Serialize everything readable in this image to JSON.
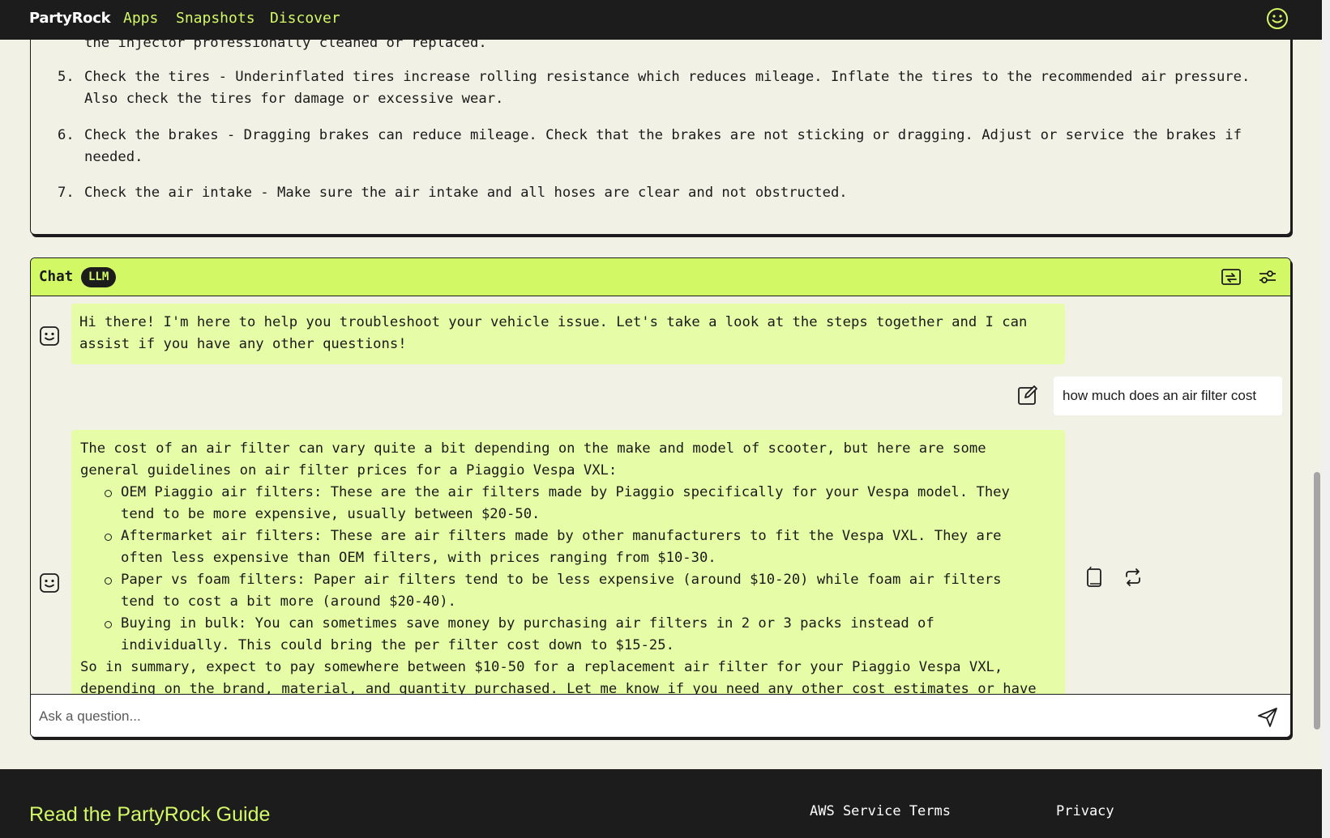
{
  "nav": {
    "brand": "PartyRock",
    "links": [
      "Apps",
      "Snapshots",
      "Discover"
    ],
    "avatar_icon": "smiley-icon"
  },
  "output": {
    "clipped_text": "the injector professionally cleaned or replaced.",
    "items": [
      {
        "num": "5.",
        "text": "Check the tires - Underinflated tires increase rolling resistance which reduces mileage. Inflate the tires to the recommended air pressure. Also check the tires for damage or excessive wear."
      },
      {
        "num": "6.",
        "text": "Check the brakes - Dragging brakes can reduce mileage. Check that the brakes are not sticking or dragging. Adjust or service the brakes if needed."
      },
      {
        "num": "7.",
        "text": "Check the air intake - Make sure the air intake and all hoses are clear and not obstructed."
      }
    ]
  },
  "chat": {
    "title": "Chat",
    "badge": "LLM",
    "header_icons": [
      "snapshot-icon",
      "settings-sliders-icon"
    ],
    "messages": {
      "bot1": "Hi there! I'm here to help you troubleshoot your vehicle issue. Let's take a look at the steps together and I can assist if you have any other questions!",
      "user1": "how much does an air filter cost",
      "bot2_intro": "The cost of an air filter can vary quite a bit depending on the make and model of scooter, but here are some general guidelines on air filter prices for a Piaggio Vespa VXL:",
      "bot2_bullets": [
        "OEM Piaggio air filters: These are the air filters made by Piaggio specifically for your Vespa model. They tend to be more expensive, usually between $20-50.",
        "Aftermarket air filters: These are air filters made by other manufacturers to fit the Vespa VXL. They are often less expensive than OEM filters, with prices ranging from $10-30.",
        "Paper vs foam filters: Paper air filters tend to be less expensive (around $10-20) while foam air filters tend to cost a bit more (around $20-40).",
        "Buying in bulk: You can sometimes save money by purchasing air filters in 2 or 3 packs instead of individually. This could bring the per filter cost down to $15-25."
      ],
      "bot2_summary": "So in summary, expect to pay somewhere between $10-50 for a replacement air filter for your Piaggio Vespa VXL, depending on the brand, material, and quantity purchased. Let me know if you need any other cost estimates or have"
    },
    "input_placeholder": "Ask a question..."
  },
  "footer": {
    "guide": "Read the PartyRock Guide",
    "links": [
      "AWS Service Terms",
      "Privacy"
    ]
  },
  "colors": {
    "accent": "#d3f866",
    "bot_bubble": "#e6fca7",
    "dark": "#1c1c1c",
    "page_bg": "#f2f1e6"
  }
}
